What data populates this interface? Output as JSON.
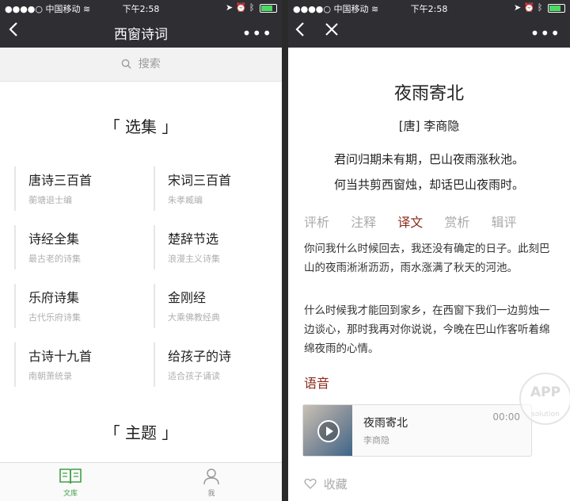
{
  "status": {
    "carrier": "中国移动",
    "time": "下午2:58"
  },
  "left": {
    "nav_title": "西窗诗词",
    "search_placeholder": "搜索",
    "section1_title": "「 选集 」",
    "section2_title": "「 主题 」",
    "collections": [
      {
        "title": "唐诗三百首",
        "subtitle": "蘅塘退士编"
      },
      {
        "title": "宋词三百首",
        "subtitle": "朱孝臧编"
      },
      {
        "title": "诗经全集",
        "subtitle": "最古老的诗集"
      },
      {
        "title": "楚辞节选",
        "subtitle": "浪漫主义诗集"
      },
      {
        "title": "乐府诗集",
        "subtitle": "古代乐府诗集"
      },
      {
        "title": "金刚经",
        "subtitle": "大乘佛教经典"
      },
      {
        "title": "古诗十九首",
        "subtitle": "南朝萧统录"
      },
      {
        "title": "给孩子的诗",
        "subtitle": "适合孩子诵读"
      }
    ],
    "tabs": [
      {
        "label": "文库",
        "icon": "book-icon",
        "active": true
      },
      {
        "label": "我",
        "icon": "person-icon",
        "active": false
      }
    ],
    "active_color": "#3fa046"
  },
  "right": {
    "poem_title": "夜雨寄北",
    "author": "[唐] 李商隐",
    "lines": [
      "君问归期未有期，巴山夜雨涨秋池。",
      "何当共剪西窗烛，却话巴山夜雨时。"
    ],
    "tabs": [
      "评析",
      "注释",
      "译文",
      "赏析",
      "辑评"
    ],
    "active_tab": "译文",
    "translation": [
      "你问我什么时候回去，我还没有确定的日子。此刻巴山的夜雨淅淅沥沥，雨水涨满了秋天的河池。",
      "什么时候我才能回到家乡，在西窗下我们一边剪烛一边谈心，那时我再对你说说，今晚在巴山作客听着绵绵夜雨的心情。"
    ],
    "audio_label": "语音",
    "audio": {
      "title": "夜雨寄北",
      "author": "李商隐",
      "duration": "00:00"
    },
    "collect_label": "收藏",
    "watermark": {
      "main": "APP",
      "sub": "solution"
    },
    "accent_color": "#8b2a1b"
  }
}
